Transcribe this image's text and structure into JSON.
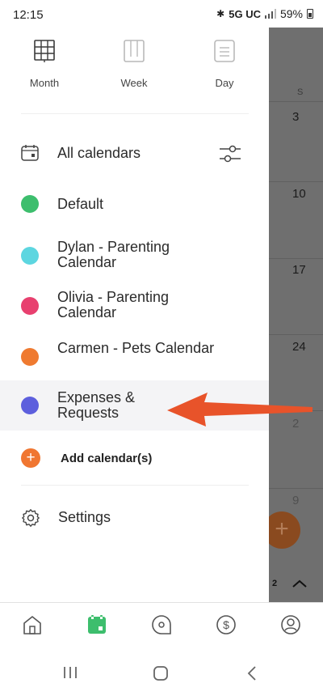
{
  "status": {
    "time": "12:15",
    "network": "5G UC",
    "battery": "59%"
  },
  "views": [
    {
      "label": "Month",
      "icon": "month-grid-icon"
    },
    {
      "label": "Week",
      "icon": "week-columns-icon"
    },
    {
      "label": "Day",
      "icon": "day-lines-icon"
    }
  ],
  "all_calendars": {
    "label": "All calendars",
    "icon": "calendar-icon",
    "filter_icon": "sliders-icon"
  },
  "calendars": [
    {
      "label": "Default",
      "color": "#3dbe6d"
    },
    {
      "label": "Dylan - Parenting Calendar",
      "color": "#5dd6e0"
    },
    {
      "label": "Olivia - Parenting Calendar",
      "color": "#e8406f"
    },
    {
      "label": "Carmen - Pets Calendar",
      "color": "#ef7a30"
    },
    {
      "label": "Expenses & Requests",
      "color": "#5d5fdd"
    }
  ],
  "add_calendar": {
    "label": "Add calendar(s)",
    "color": "#f07631"
  },
  "settings": {
    "label": "Settings",
    "icon": "gear-icon"
  },
  "background_calendar": {
    "weekday": "S",
    "dates": [
      "3",
      "10",
      "17",
      "24",
      "2",
      "9"
    ],
    "page": "2"
  },
  "annotation": {
    "arrow_color": "#e8532a"
  },
  "bottom_nav": [
    "home-icon",
    "calendar-icon",
    "message-icon",
    "dollar-icon",
    "profile-icon"
  ],
  "accent": "#3dbe6d"
}
